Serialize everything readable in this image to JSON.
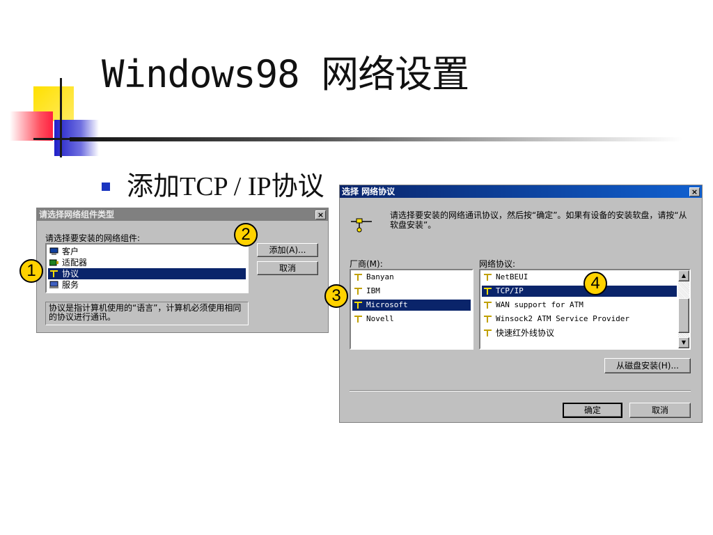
{
  "slide": {
    "title": "Windows98 网络设置",
    "bullet": "添加TCP / IP协议"
  },
  "dialog1": {
    "title": "请选择网络组件类型",
    "close": "×",
    "prompt": "请选择要安装的网络组件:",
    "items": [
      {
        "label": "客户",
        "icon": "client-icon",
        "selected": false
      },
      {
        "label": "适配器",
        "icon": "adapter-icon",
        "selected": false
      },
      {
        "label": "协议",
        "icon": "protocol-icon",
        "selected": true
      },
      {
        "label": "服务",
        "icon": "service-icon",
        "selected": false
      }
    ],
    "add_label": "添加(A)...",
    "cancel_label": "取消",
    "description": "协议是指计算机使用的“语言”，计算机必须使用相同的协议进行通讯。"
  },
  "dialog2": {
    "title": "选择 网络协议",
    "close": "×",
    "instruction": "请选择要安装的网络通讯协议，然后按“确定”。如果有设备的安装软盘，请按“从软盘安装”。",
    "vendor_label": "厂商(M):",
    "vendors": [
      {
        "label": "Banyan",
        "selected": false
      },
      {
        "label": "IBM",
        "selected": false
      },
      {
        "label": "Microsoft",
        "selected": true
      },
      {
        "label": "Novell",
        "selected": false
      }
    ],
    "protocol_label": "网络协议:",
    "protocols": [
      {
        "label": "NetBEUI",
        "selected": false
      },
      {
        "label": "TCP/IP",
        "selected": true
      },
      {
        "label": "WAN support for ATM",
        "selected": false
      },
      {
        "label": "Winsock2 ATM Service Provider",
        "selected": false
      },
      {
        "label": "快速红外线协议",
        "selected": false
      }
    ],
    "disk_label": "从磁盘安装(H)...",
    "ok_label": "确定",
    "cancel_label": "取消"
  },
  "badges": [
    "1",
    "2",
    "3",
    "4"
  ],
  "colors": {
    "selection": "#0a246a",
    "badge": "#ffd200",
    "bullet": "#1a35c0",
    "dialog_face": "#c0c0c0"
  }
}
